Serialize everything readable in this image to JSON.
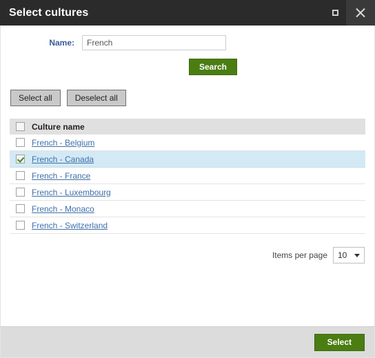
{
  "window": {
    "title": "Select cultures",
    "maximize_icon": "maximize-icon",
    "close_icon": "close-icon"
  },
  "search_form": {
    "name_label": "Name:",
    "name_value": "French",
    "name_placeholder": "",
    "search_button": "Search"
  },
  "toolbar": {
    "select_all": "Select all",
    "deselect_all": "Deselect all"
  },
  "grid": {
    "header": {
      "checkbox_checked": false,
      "column_label": "Culture name"
    },
    "rows": [
      {
        "label": "French - Belgium",
        "checked": false,
        "selected": false
      },
      {
        "label": "French - Canada",
        "checked": true,
        "selected": true
      },
      {
        "label": "French - France",
        "checked": false,
        "selected": false
      },
      {
        "label": "French - Luxembourg",
        "checked": false,
        "selected": false
      },
      {
        "label": "French - Monaco",
        "checked": false,
        "selected": false
      },
      {
        "label": "French - Switzerland",
        "checked": false,
        "selected": false
      }
    ]
  },
  "pager": {
    "label": "Items per page",
    "value": "10",
    "caret_icon": "chevron-down-icon"
  },
  "footer": {
    "select_button": "Select"
  },
  "colors": {
    "titlebar_bg": "#2b2b2b",
    "accent_green": "#4a7d12",
    "link_blue": "#3f6fa8",
    "label_blue": "#3a5a99",
    "row_selected_bg": "#d3eaf5",
    "header_bg": "#e0e0e0",
    "footer_bg": "#dcdcdc"
  }
}
